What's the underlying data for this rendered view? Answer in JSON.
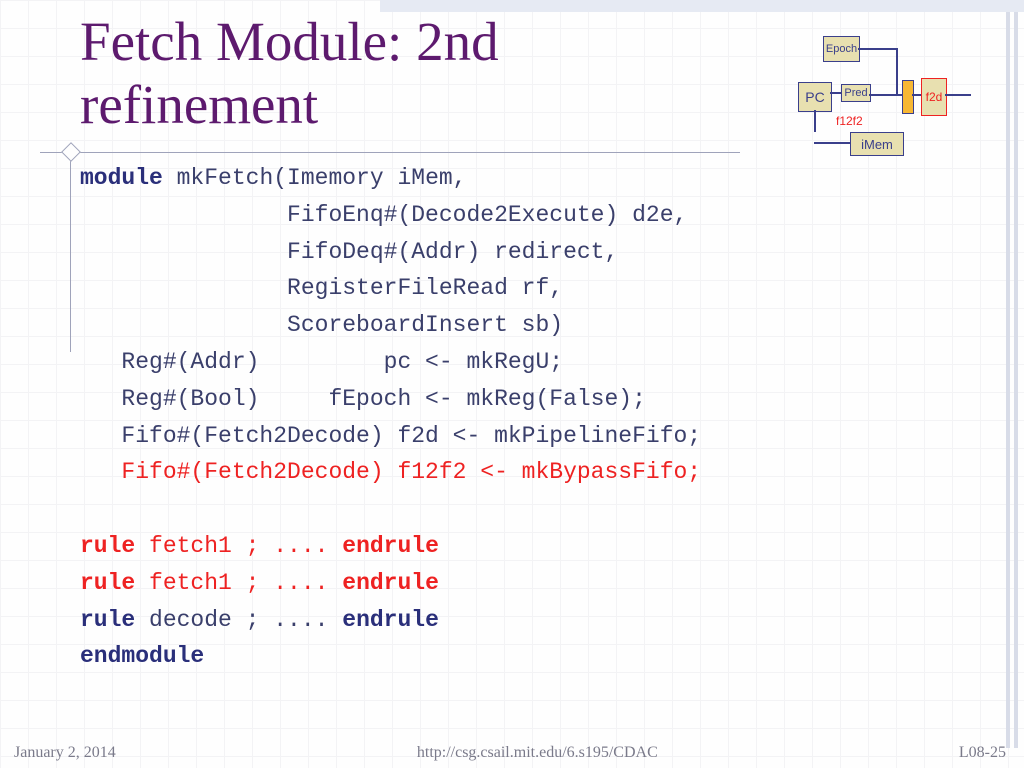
{
  "slide": {
    "title_line1": "Fetch Module: 2nd",
    "title_line2": "refinement"
  },
  "code": {
    "l1_kw": "module",
    "l1": " mkFetch(Imemory iMem,",
    "l2": "               FifoEnq#(Decode2Execute) d2e,",
    "l3": "               FifoDeq#(Addr) redirect,",
    "l4": "               RegisterFileRead rf,",
    "l5": "               ScoreboardInsert sb)",
    "l6": "   Reg#(Addr)         pc <- mkRegU;",
    "l7": "   Reg#(Bool)     fEpoch <- mkReg(False);",
    "l8": "   Fifo#(Fetch2Decode) f2d <- mkPipelineFifo;",
    "l9": "   Fifo#(Fetch2Decode) f12f2 <- mkBypassFifo;",
    "r1_kw1": "rule",
    "r1_mid": " fetch1 ; .... ",
    "r1_kw2": "endrule",
    "r2_kw1": "rule",
    "r2_mid": " fetch1 ; .... ",
    "r2_kw2": "endrule",
    "r3_kw1": "rule",
    "r3_mid": " decode ; .... ",
    "r3_kw2": "endrule",
    "endmod": "endmodule"
  },
  "diagram": {
    "epoch": "Epoch",
    "pc": "PC",
    "pred": "Pred",
    "imem": "iMem",
    "f2d": "f2d",
    "f12f2": "f12f2"
  },
  "footer": {
    "date": "January 2, 2014",
    "url": "http://csg.csail.mit.edu/6.s195/CDAC",
    "pageref": "L08-25"
  }
}
